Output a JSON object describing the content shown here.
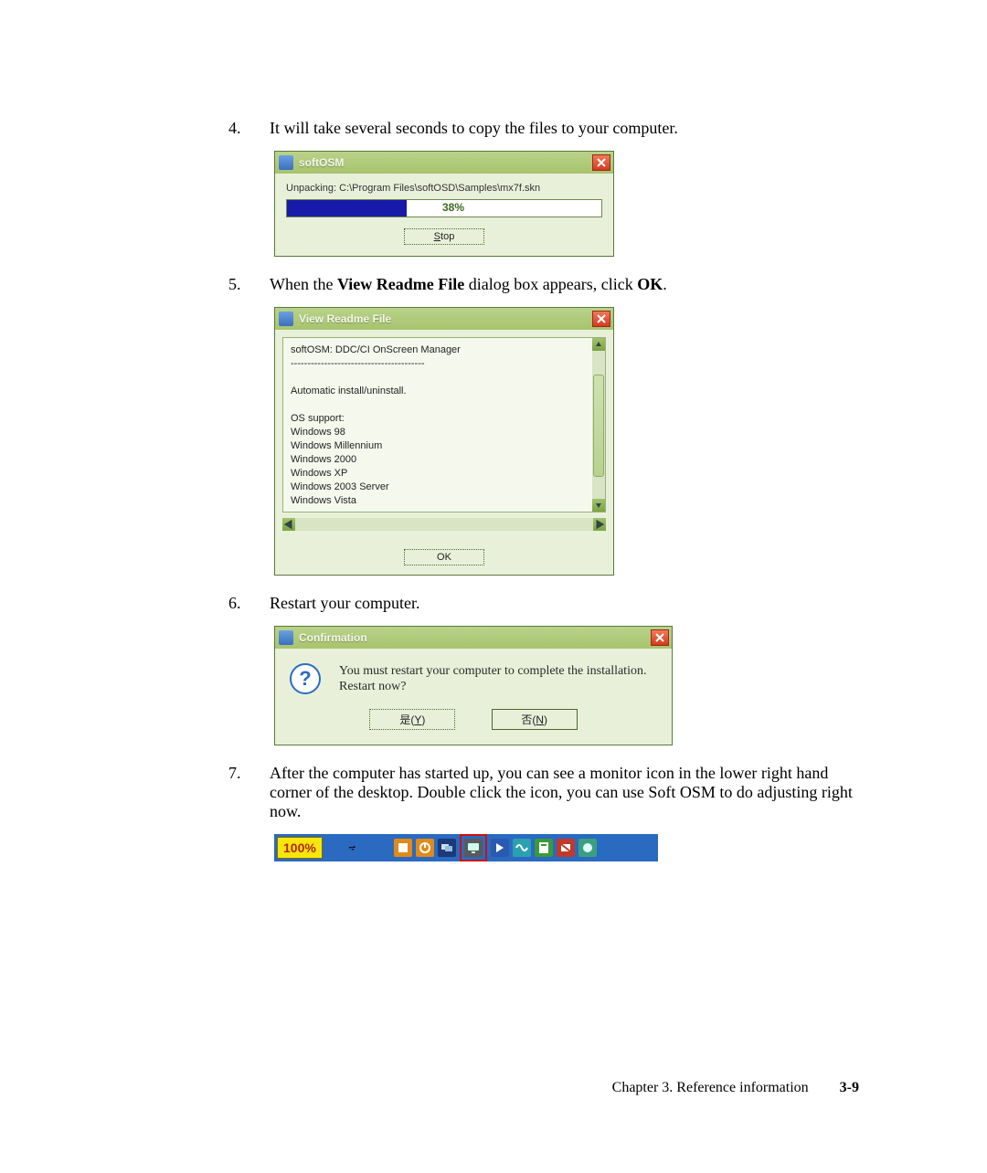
{
  "steps": {
    "s4_num": "4.",
    "s4_text": "It will take several seconds to copy the files to your computer.",
    "s5_num": "5.",
    "s5_pre": "When the ",
    "s5_bold": "View Readme File",
    "s5_mid": " dialog box appears, click ",
    "s5_bold2": "OK",
    "s5_post": ".",
    "s6_num": "6.",
    "s6_text": "Restart your computer.",
    "s7_num": "7.",
    "s7_text": "After the computer has started up, you can see a monitor icon in the lower right hand corner of the desktop. Double click the icon, you can use Soft OSM to do adjusting right now."
  },
  "dlg1": {
    "title": "softOSM",
    "line": "Unpacking: C:\\Program Files\\softOSD\\Samples\\mx7f.skn",
    "percent": "38%",
    "stop_u": "S",
    "stop_rest": "top"
  },
  "dlg2": {
    "title": "View Readme File",
    "readme": "softOSM: DDC/CI OnScreen Manager\n----------------------------------------\n\nAutomatic install/uninstall.\n\nOS support:\nWindows 98\nWindows Millennium\nWindows 2000\nWindows XP\nWindows 2003 Server\nWindows Vista\n\nDisplay control requires a DDC/CI monitor",
    "ok": "OK"
  },
  "dlg3": {
    "title": "Confirmation",
    "msg": "You must restart your computer to complete the installation.\nRestart now?",
    "yes_label": "是(",
    "yes_u": "Y",
    "yes_tail": ")",
    "no_label": "否(",
    "no_u": "N",
    "no_tail": ")"
  },
  "tray": {
    "badge": "100%"
  },
  "footer": {
    "chapter": "Chapter 3. Reference information",
    "page": "3-9"
  }
}
